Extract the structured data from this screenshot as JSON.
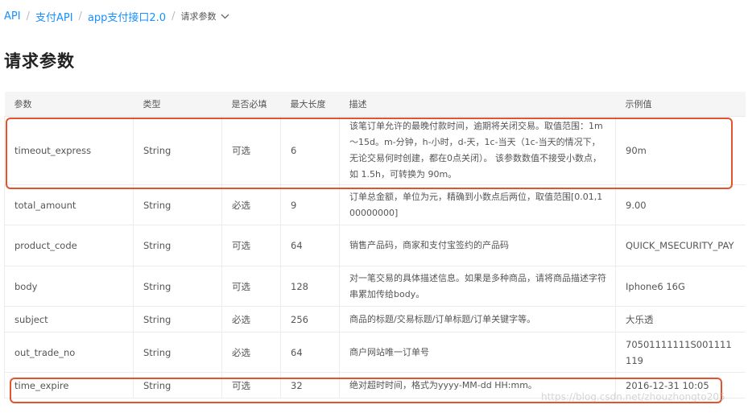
{
  "breadcrumb": {
    "items": [
      "API",
      "支付API",
      "app支付接口2.0"
    ],
    "current": "请求参数"
  },
  "page_title": "请求参数",
  "table": {
    "headers": [
      "参数",
      "类型",
      "是否必填",
      "最大长度",
      "描述",
      "示例值"
    ],
    "rows": [
      {
        "param": "timeout_express",
        "type": "String",
        "required": "可选",
        "max_length": "6",
        "description": "该笔订单允许的最晚付款时间，逾期将关闭交易。取值范围：1m～15d。m-分钟，h-小时，d-天，1c-当天（1c-当天的情况下，无论交易何时创建，都在0点关闭）。 该参数数值不接受小数点， 如 1.5h，可转换为 90m。",
        "example": "90m"
      },
      {
        "param": "total_amount",
        "type": "String",
        "required": "必选",
        "max_length": "9",
        "description": "订单总金额，单位为元，精确到小数点后两位，取值范围[0.01,100000000]",
        "example": "9.00"
      },
      {
        "param": "product_code",
        "type": "String",
        "required": "可选",
        "max_length": "64",
        "description": "销售产品码，商家和支付宝签约的产品码",
        "example": "QUICK_MSECURITY_PAY"
      },
      {
        "param": "body",
        "type": "String",
        "required": "可选",
        "max_length": "128",
        "description": "对一笔交易的具体描述信息。如果是多种商品，请将商品描述字符串累加传给body。",
        "example": "Iphone6 16G"
      },
      {
        "param": "subject",
        "type": "String",
        "required": "必选",
        "max_length": "256",
        "description": "商品的标题/交易标题/订单标题/订单关键字等。",
        "example": "大乐透"
      },
      {
        "param": "out_trade_no",
        "type": "String",
        "required": "必选",
        "max_length": "64",
        "description": "商户网站唯一订单号",
        "example": "70501111111S001111119"
      },
      {
        "param": "time_expire",
        "type": "String",
        "required": "可选",
        "max_length": "32",
        "description": "绝对超时时间，格式为yyyy-MM-dd HH:mm。",
        "example": "2016-12-31 10:05"
      }
    ]
  },
  "watermark": "https://blog.csdn.net/zhouzhongto205",
  "colors": {
    "link": "#1890ff",
    "highlight": "#e5532d",
    "header_bg": "#f5f5f5"
  }
}
